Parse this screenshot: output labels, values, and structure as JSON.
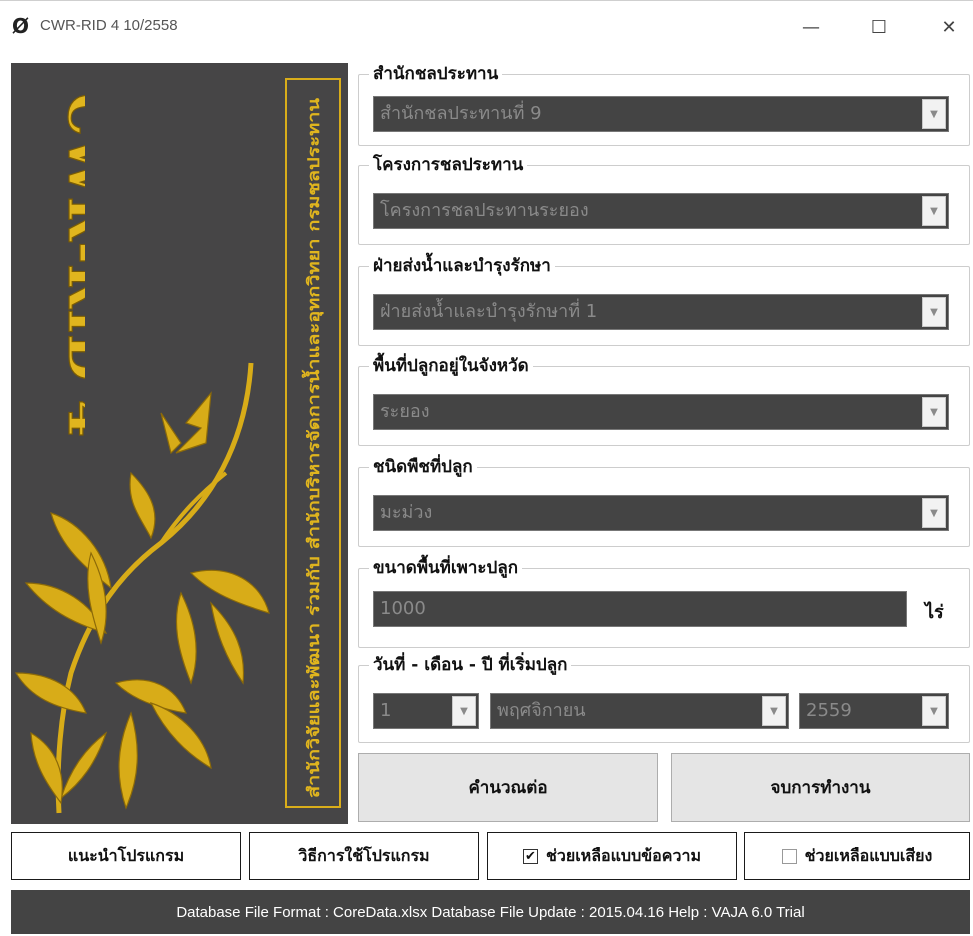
{
  "window": {
    "icon": "leaf-slash-icon",
    "title": "CWR-RID 4 10/2558",
    "controls": [
      "minimize-icon",
      "maximize-icon",
      "close-icon"
    ]
  },
  "banner": {
    "title": "CWR-RID 4",
    "subtitle": "สำนักวิจัยและพัฒนา ร่วมกับ สำนักบริหารจัดการน้ำและอุทกวิทยา กรมชลประทาน",
    "accent": "#d9ad1a",
    "background": "#464546"
  },
  "groups": {
    "office": {
      "label": "สำนักชลประทาน",
      "value": "สำนักชลประทานที่ 9"
    },
    "project": {
      "label": "โครงการชลประทาน",
      "value": "โครงการชลประทานระยอง"
    },
    "division": {
      "label": "ฝ่ายส่งน้ำและบำรุงรักษา",
      "value": "ฝ่ายส่งน้ำและบำรุงรักษาที่ 1"
    },
    "province": {
      "label": "พื้นที่ปลูกอยู่ในจังหวัด",
      "value": "ระยอง"
    },
    "crop": {
      "label": "ชนิดพืชที่ปลูก",
      "value": "มะม่วง"
    },
    "area": {
      "label": "ขนาดพื้นที่เพาะปลูก",
      "value": "1000",
      "unit": "ไร่"
    },
    "date": {
      "label": "วันที่ - เดือน - ปี ที่เริ่มปลูก",
      "day": "1",
      "month": "พฤศจิกายน",
      "year": "2559"
    }
  },
  "actions": {
    "calculate": "คำนวณต่อ",
    "exit": "จบการทำงาน"
  },
  "bottom": {
    "intro": "แนะนำโปรแกรม",
    "howto": "วิธีการใช้โปรแกรม",
    "text_help": {
      "label": "ช่วยเหลือแบบข้อความ",
      "checked": true
    },
    "voice_help": {
      "label": "ช่วยเหลือแบบเสียง",
      "checked": false
    }
  },
  "status": "Database File Format : CoreData.xlsx   Database File Update : 2015.04.16   Help : VAJA 6.0 Trial"
}
